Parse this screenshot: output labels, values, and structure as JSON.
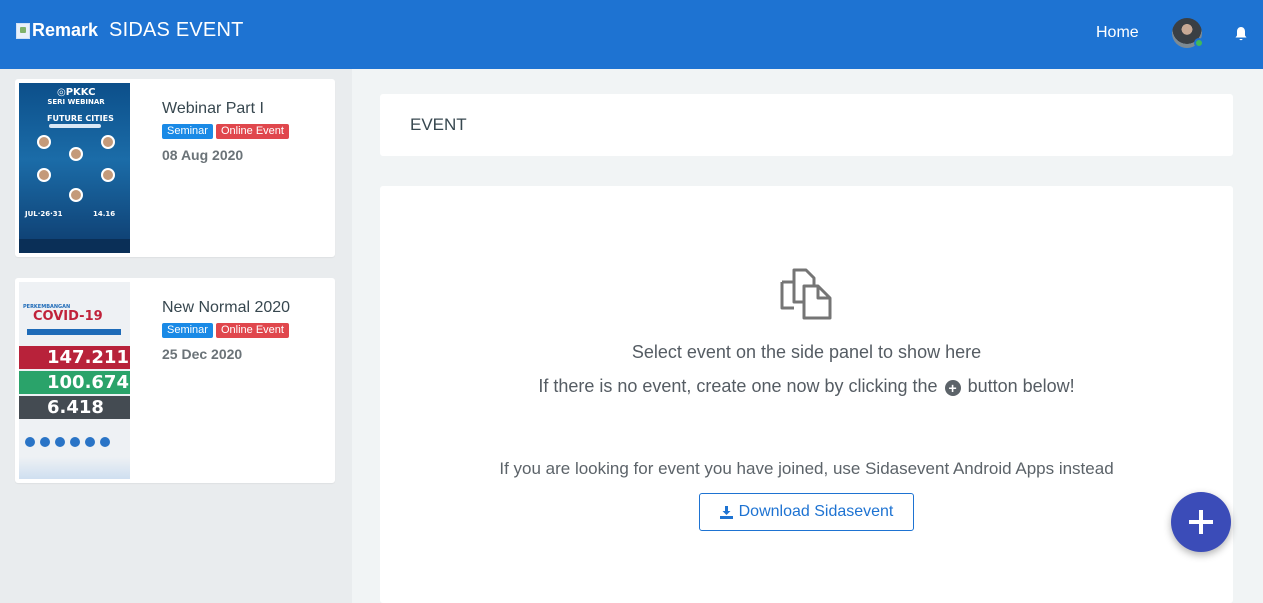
{
  "header": {
    "brand_logo_alt": "Remark",
    "app_title": "SIDAS EVENT",
    "nav_home": "Home",
    "colors": {
      "bar": "#1e73d2",
      "online_dot": "#3fba5a"
    }
  },
  "sidebar": {
    "events": [
      {
        "title": "Webinar Part I",
        "badges": [
          "Seminar",
          "Online Event"
        ],
        "date": "08 Aug 2020",
        "image": "webinar-poster"
      },
      {
        "title": "New Normal 2020",
        "badges": [
          "Seminar",
          "Online Event"
        ],
        "date": "25 Dec 2020",
        "image": "covid-poster"
      }
    ],
    "badge_colors": {
      "category": "#1a8ae6",
      "type": "#e0474d"
    }
  },
  "main": {
    "header_title": "EVENT",
    "empty_state": {
      "icon": "documents-icon",
      "line1": "Select event on the side panel to show here",
      "line2_before": "If there is no event, create one now by clicking the",
      "line2_icon": "plus-circle-icon",
      "line2_after": "button below!",
      "line3": "If you are looking for event you have joined, use Sidasevent Android Apps instead",
      "download_button": "Download Sidasevent"
    }
  },
  "fab": {
    "icon": "plus-icon",
    "color": "#3b4cb8"
  }
}
